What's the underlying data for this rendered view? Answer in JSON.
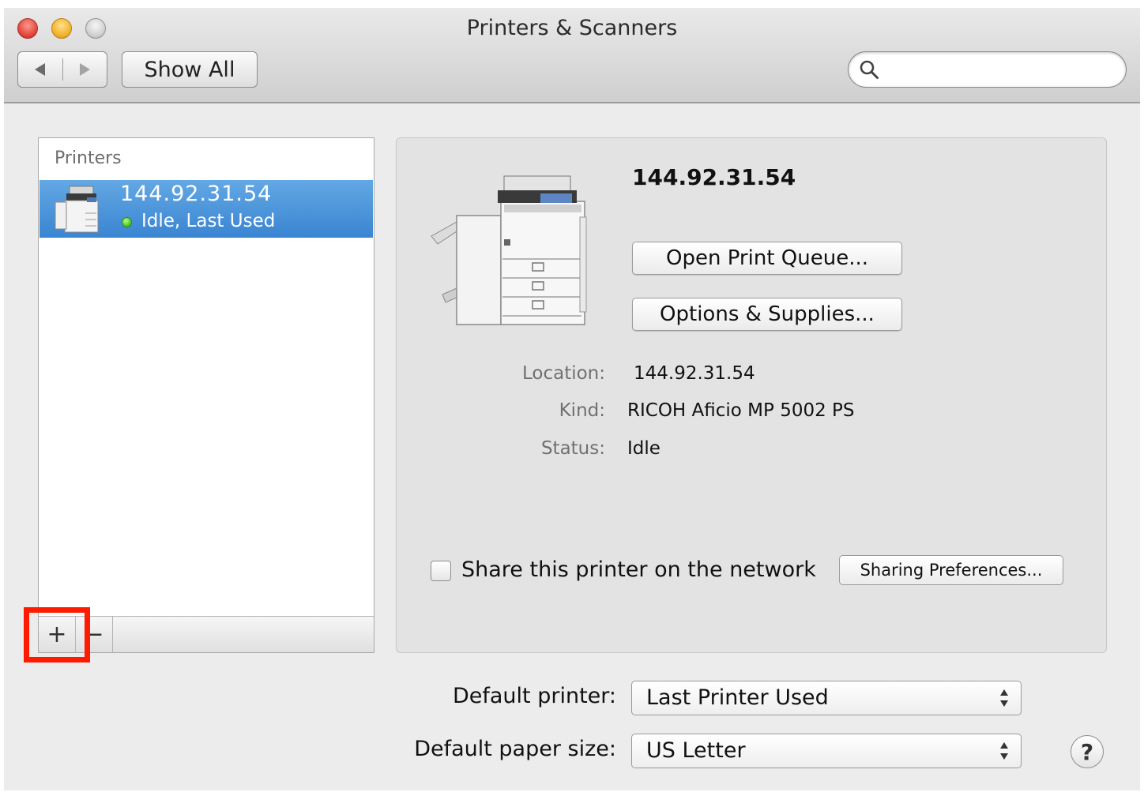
{
  "window": {
    "title": "Printers & Scanners"
  },
  "toolbar": {
    "back_icon": "triangle-left-icon",
    "forward_icon": "triangle-right-icon",
    "show_all_label": "Show All",
    "search_value": "",
    "search_placeholder": ""
  },
  "printers_list": {
    "header": "Printers",
    "items": [
      {
        "name": "144.92.31.54",
        "status": "Idle, Last Used",
        "status_color": "#3fbf1f",
        "selected": true
      }
    ],
    "add_label": "+",
    "remove_label": "−"
  },
  "details": {
    "name": "144.92.31.54",
    "open_queue_label": "Open Print Queue...",
    "options_label": "Options & Supplies...",
    "location_label": "Location:",
    "location_value": "144.92.31.54",
    "kind_label": "Kind:",
    "kind_value": "RICOH Aficio MP 5002 PS",
    "status_label": "Status:",
    "status_value": "Idle",
    "share_label": "Share this printer on the network",
    "share_checked": false,
    "sharing_prefs_label": "Sharing Preferences..."
  },
  "defaults": {
    "printer_label": "Default printer:",
    "printer_value": "Last Printer Used",
    "paper_label": "Default paper size:",
    "paper_value": "US Letter"
  },
  "help_label": "?",
  "colors": {
    "selection": "#3a85d2",
    "highlight": "#ff1a00",
    "close": "#e0443a",
    "minimize": "#f0b12b",
    "zoom": "#cfcfcf"
  }
}
